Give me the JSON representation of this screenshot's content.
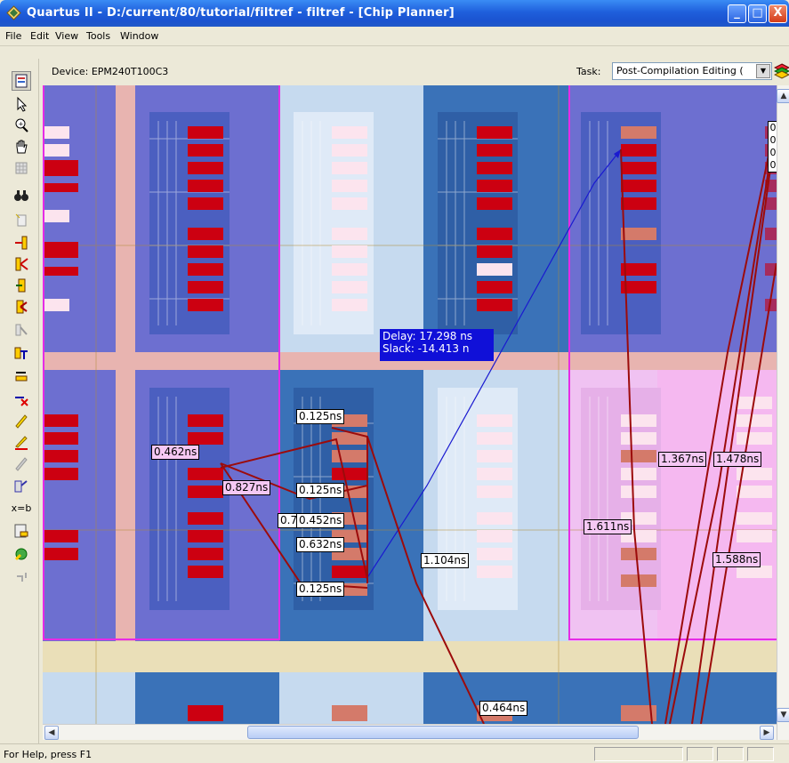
{
  "window": {
    "title": "Quartus II - D:/current/80/tutorial/filtref - filtref - [Chip Planner]",
    "minimize_glyph": "_",
    "maximize_glyph": "□",
    "close_glyph": "X"
  },
  "menu": [
    "File",
    "Edit",
    "View",
    "Tools",
    "Window"
  ],
  "device_bar": {
    "device_label": "Device: EPM240T100C3",
    "task_label": "Task:",
    "task_value": "Post-Compilation Editing (",
    "layers_icon": "layers-icon"
  },
  "toolbar_icons": [
    "report-icon",
    "pointer-icon",
    "zoom-icon",
    "hand-icon",
    "grid-icon",
    "binoculars-icon",
    "bookmark-icon",
    "fan-in-icon",
    "fan-out-icon",
    "immediate-fan-in-icon",
    "immediate-fan-out-icon",
    "path-icon",
    "delays-icon",
    "critical-path-icon",
    "clear-connections-icon",
    "highlight-routing-icon",
    "highlight-clear-icon",
    "disabled-highlight-icon",
    "resource-property-icon",
    "equation-icon",
    "editor-icon",
    "run-icon",
    "undo-icon"
  ],
  "equation_icon_label": "x=b",
  "colors": {
    "lab_dark": "#3a72b8",
    "lab_purple": "#6d6fd0",
    "lab_light": "#c6daef",
    "lab_pink": "#f5b8f0",
    "row_channel": "#eadfb8",
    "col_channel": "#e8b4b0",
    "path_line": "#9c0b0b",
    "critical_line": "#1a1ad0",
    "selection_border": "#e62be6"
  },
  "delay_tooltip": {
    "delay": "Delay: 17.298 ns",
    "slack": "Slack: -14.413 n"
  },
  "delay_labels": [
    {
      "id": "d-0125-top",
      "text": "0.125ns",
      "style": "white"
    },
    {
      "id": "d-0462",
      "text": "0.462ns",
      "style": "pink"
    },
    {
      "id": "d-0827",
      "text": "0.827ns",
      "style": "pink"
    },
    {
      "id": "d-0125-mid",
      "text": "0.125ns",
      "style": "white"
    },
    {
      "id": "d-07",
      "text": "0.7",
      "style": "white"
    },
    {
      "id": "d-0452",
      "text": "0.452ns",
      "style": "white"
    },
    {
      "id": "d-0632",
      "text": "0.632ns",
      "style": "white"
    },
    {
      "id": "d-0125-bot",
      "text": "0.125ns",
      "style": "white"
    },
    {
      "id": "d-1104",
      "text": "1.104ns",
      "style": "white"
    },
    {
      "id": "d-0464",
      "text": "0.464ns",
      "style": "white"
    },
    {
      "id": "d-1611",
      "text": "1.611ns",
      "style": "pink"
    },
    {
      "id": "d-1367",
      "text": "1.367ns",
      "style": "pink"
    },
    {
      "id": "d-1478",
      "text": "1.478ns",
      "style": "pink"
    },
    {
      "id": "d-1588",
      "text": "1.588ns",
      "style": "pink"
    }
  ],
  "edge_labels": [
    "0",
    "0",
    "0",
    "0"
  ],
  "status": {
    "text": "For Help, press F1"
  }
}
